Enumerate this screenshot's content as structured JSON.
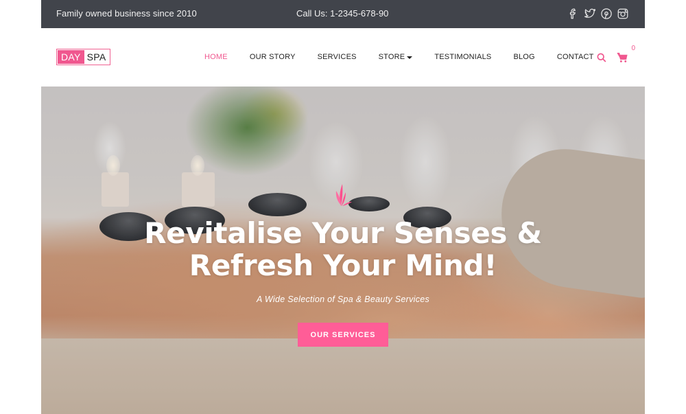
{
  "topbar": {
    "tagline": "Family owned business since 2010",
    "phone": "Call Us: 1-2345-678-90",
    "social": [
      {
        "name": "facebook-icon"
      },
      {
        "name": "twitter-icon"
      },
      {
        "name": "pinterest-icon"
      },
      {
        "name": "instagram-icon"
      }
    ]
  },
  "header": {
    "logo": {
      "part1": "DAY",
      "part2": "SPA"
    },
    "nav": [
      {
        "label": "HOME",
        "active": true
      },
      {
        "label": "OUR STORY"
      },
      {
        "label": "SERVICES"
      },
      {
        "label": "STORE",
        "has_dropdown": true
      },
      {
        "label": "TESTIMONIALS"
      },
      {
        "label": "BLOG"
      },
      {
        "label": "CONTACT"
      }
    ],
    "cart_count": "0"
  },
  "hero": {
    "title_line1": "Revitalise Your Senses &",
    "title_line2": "Refresh Your Mind!",
    "subtitle": "A Wide Selection of Spa & Beauty Services",
    "cta_label": "OUR SERVICES"
  },
  "colors": {
    "accent": "#f0588f",
    "button": "#ff5d97",
    "topbar_bg": "#41444b"
  }
}
